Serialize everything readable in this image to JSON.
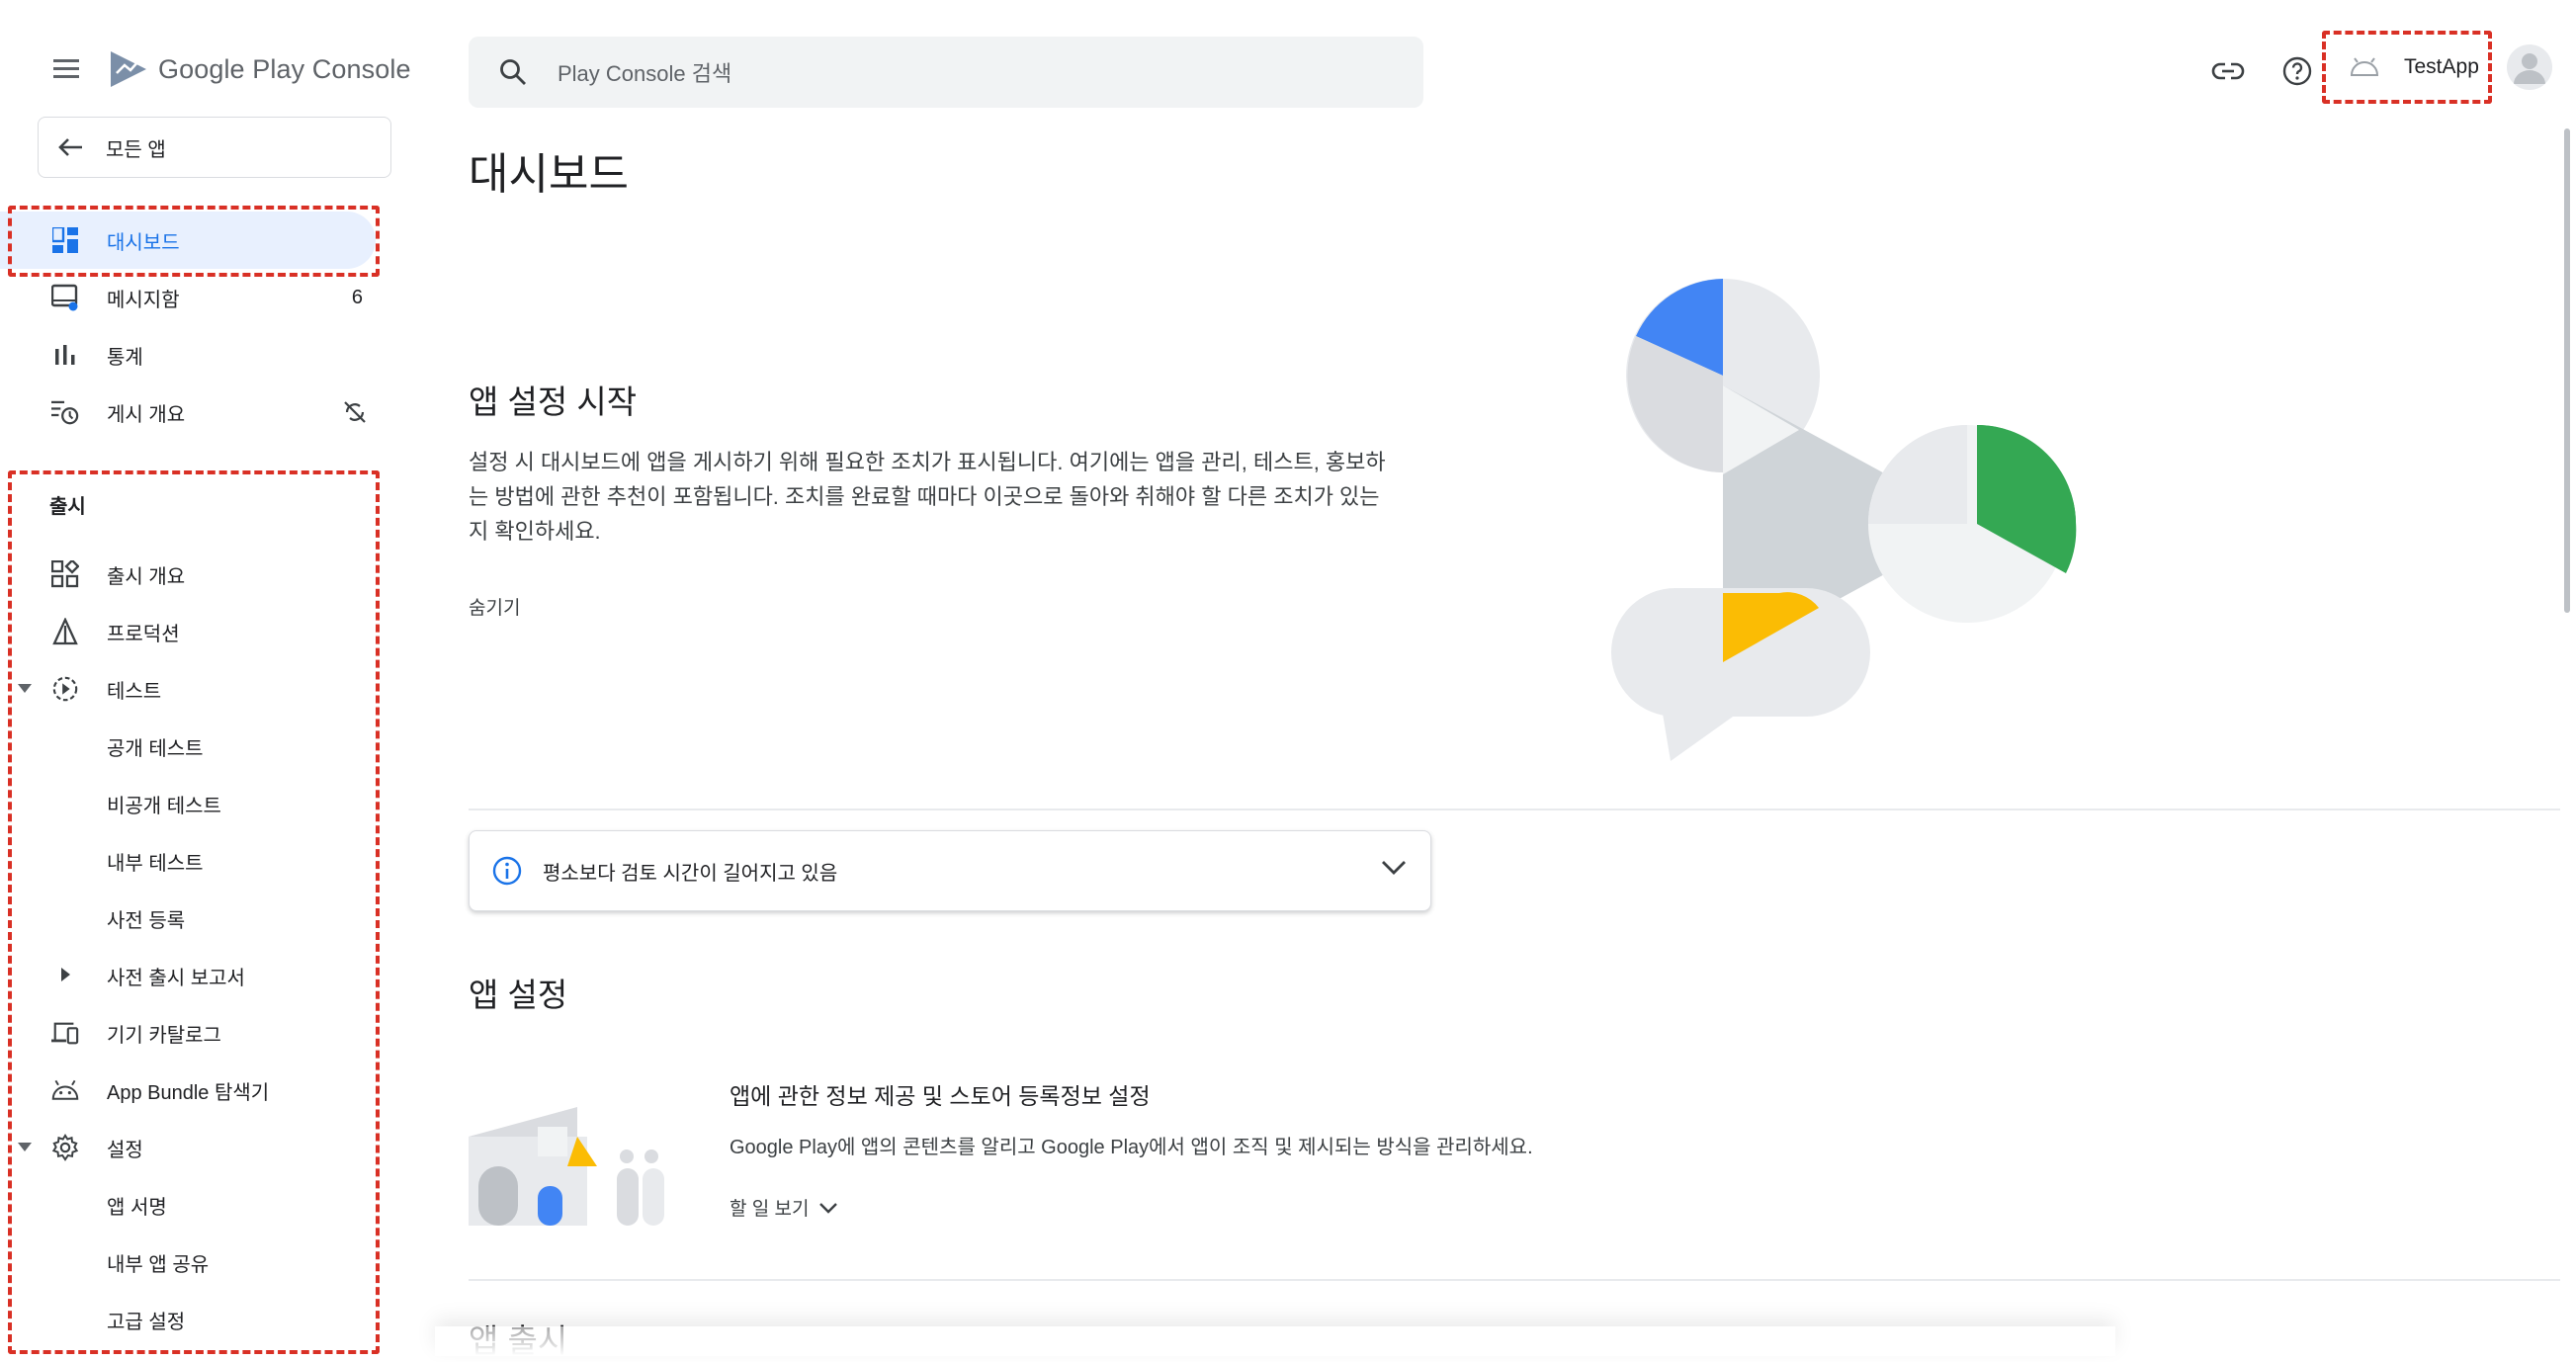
{
  "brand": {
    "google": "Google",
    "play_console": "Play Console"
  },
  "sidebar": {
    "all_apps": "모든 앱",
    "items": [
      {
        "label": "대시보드",
        "icon": "dashboard-icon"
      },
      {
        "label": "메시지함",
        "badge": "6",
        "icon": "inbox-icon"
      },
      {
        "label": "통계",
        "icon": "bar-chart-icon"
      },
      {
        "label": "게시 개요",
        "icon": "publishing-overview-icon"
      }
    ],
    "release_heading": "출시",
    "release_items": [
      {
        "label": "출시 개요",
        "icon": "release-overview-icon"
      },
      {
        "label": "프로덕션",
        "icon": "production-icon"
      },
      {
        "label": "테스트",
        "icon": "testing-icon"
      },
      {
        "label": "공개 테스트"
      },
      {
        "label": "비공개 테스트"
      },
      {
        "label": "내부 테스트"
      },
      {
        "label": "사전 등록"
      },
      {
        "label": "사전 출시 보고서"
      },
      {
        "label": "기기 카탈로그",
        "icon": "device-catalog-icon"
      },
      {
        "label": "App Bundle 탐색기",
        "icon": "android-icon"
      },
      {
        "label": "설정",
        "icon": "gear-icon"
      },
      {
        "label": "앱 서명"
      },
      {
        "label": "내부 앱 공유"
      },
      {
        "label": "고급 설정"
      }
    ]
  },
  "search": {
    "placeholder": "Play Console 검색"
  },
  "header": {
    "app_name": "TestApp"
  },
  "main": {
    "title": "대시보드",
    "intro": {
      "title": "앱 설정 시작",
      "description": "설정 시 대시보드에 앱을 게시하기 위해 필요한 조치가 표시됩니다. 여기에는 앱을 관리, 테스트, 홍보하는 방법에 관한 추천이 포함됩니다. 조치를 완료할 때마다 이곳으로 돌아와 취해야 할 다른 조치가 있는지 확인하세요.",
      "hide": "숨기기"
    },
    "notice": "평소보다 검토 시간이 길어지고 있음",
    "setup": {
      "title": "앱 설정",
      "task_title": "앱에 관한 정보 제공 및 스토어 등록정보 설정",
      "task_desc": "Google Play에 앱의 콘텐츠를 알리고 Google Play에서 앱이 조직 및 제시되는 방식을 관리하세요.",
      "task_link": "할 일 보기"
    },
    "release_title": "앱 출시"
  },
  "colors": {
    "accent": "#1a73e8",
    "active_bg": "#e8f0fe",
    "annotation_red": "#d93025",
    "illustration_blue": "#4285f4",
    "illustration_green": "#34a853",
    "illustration_yellow": "#fbbc04"
  }
}
